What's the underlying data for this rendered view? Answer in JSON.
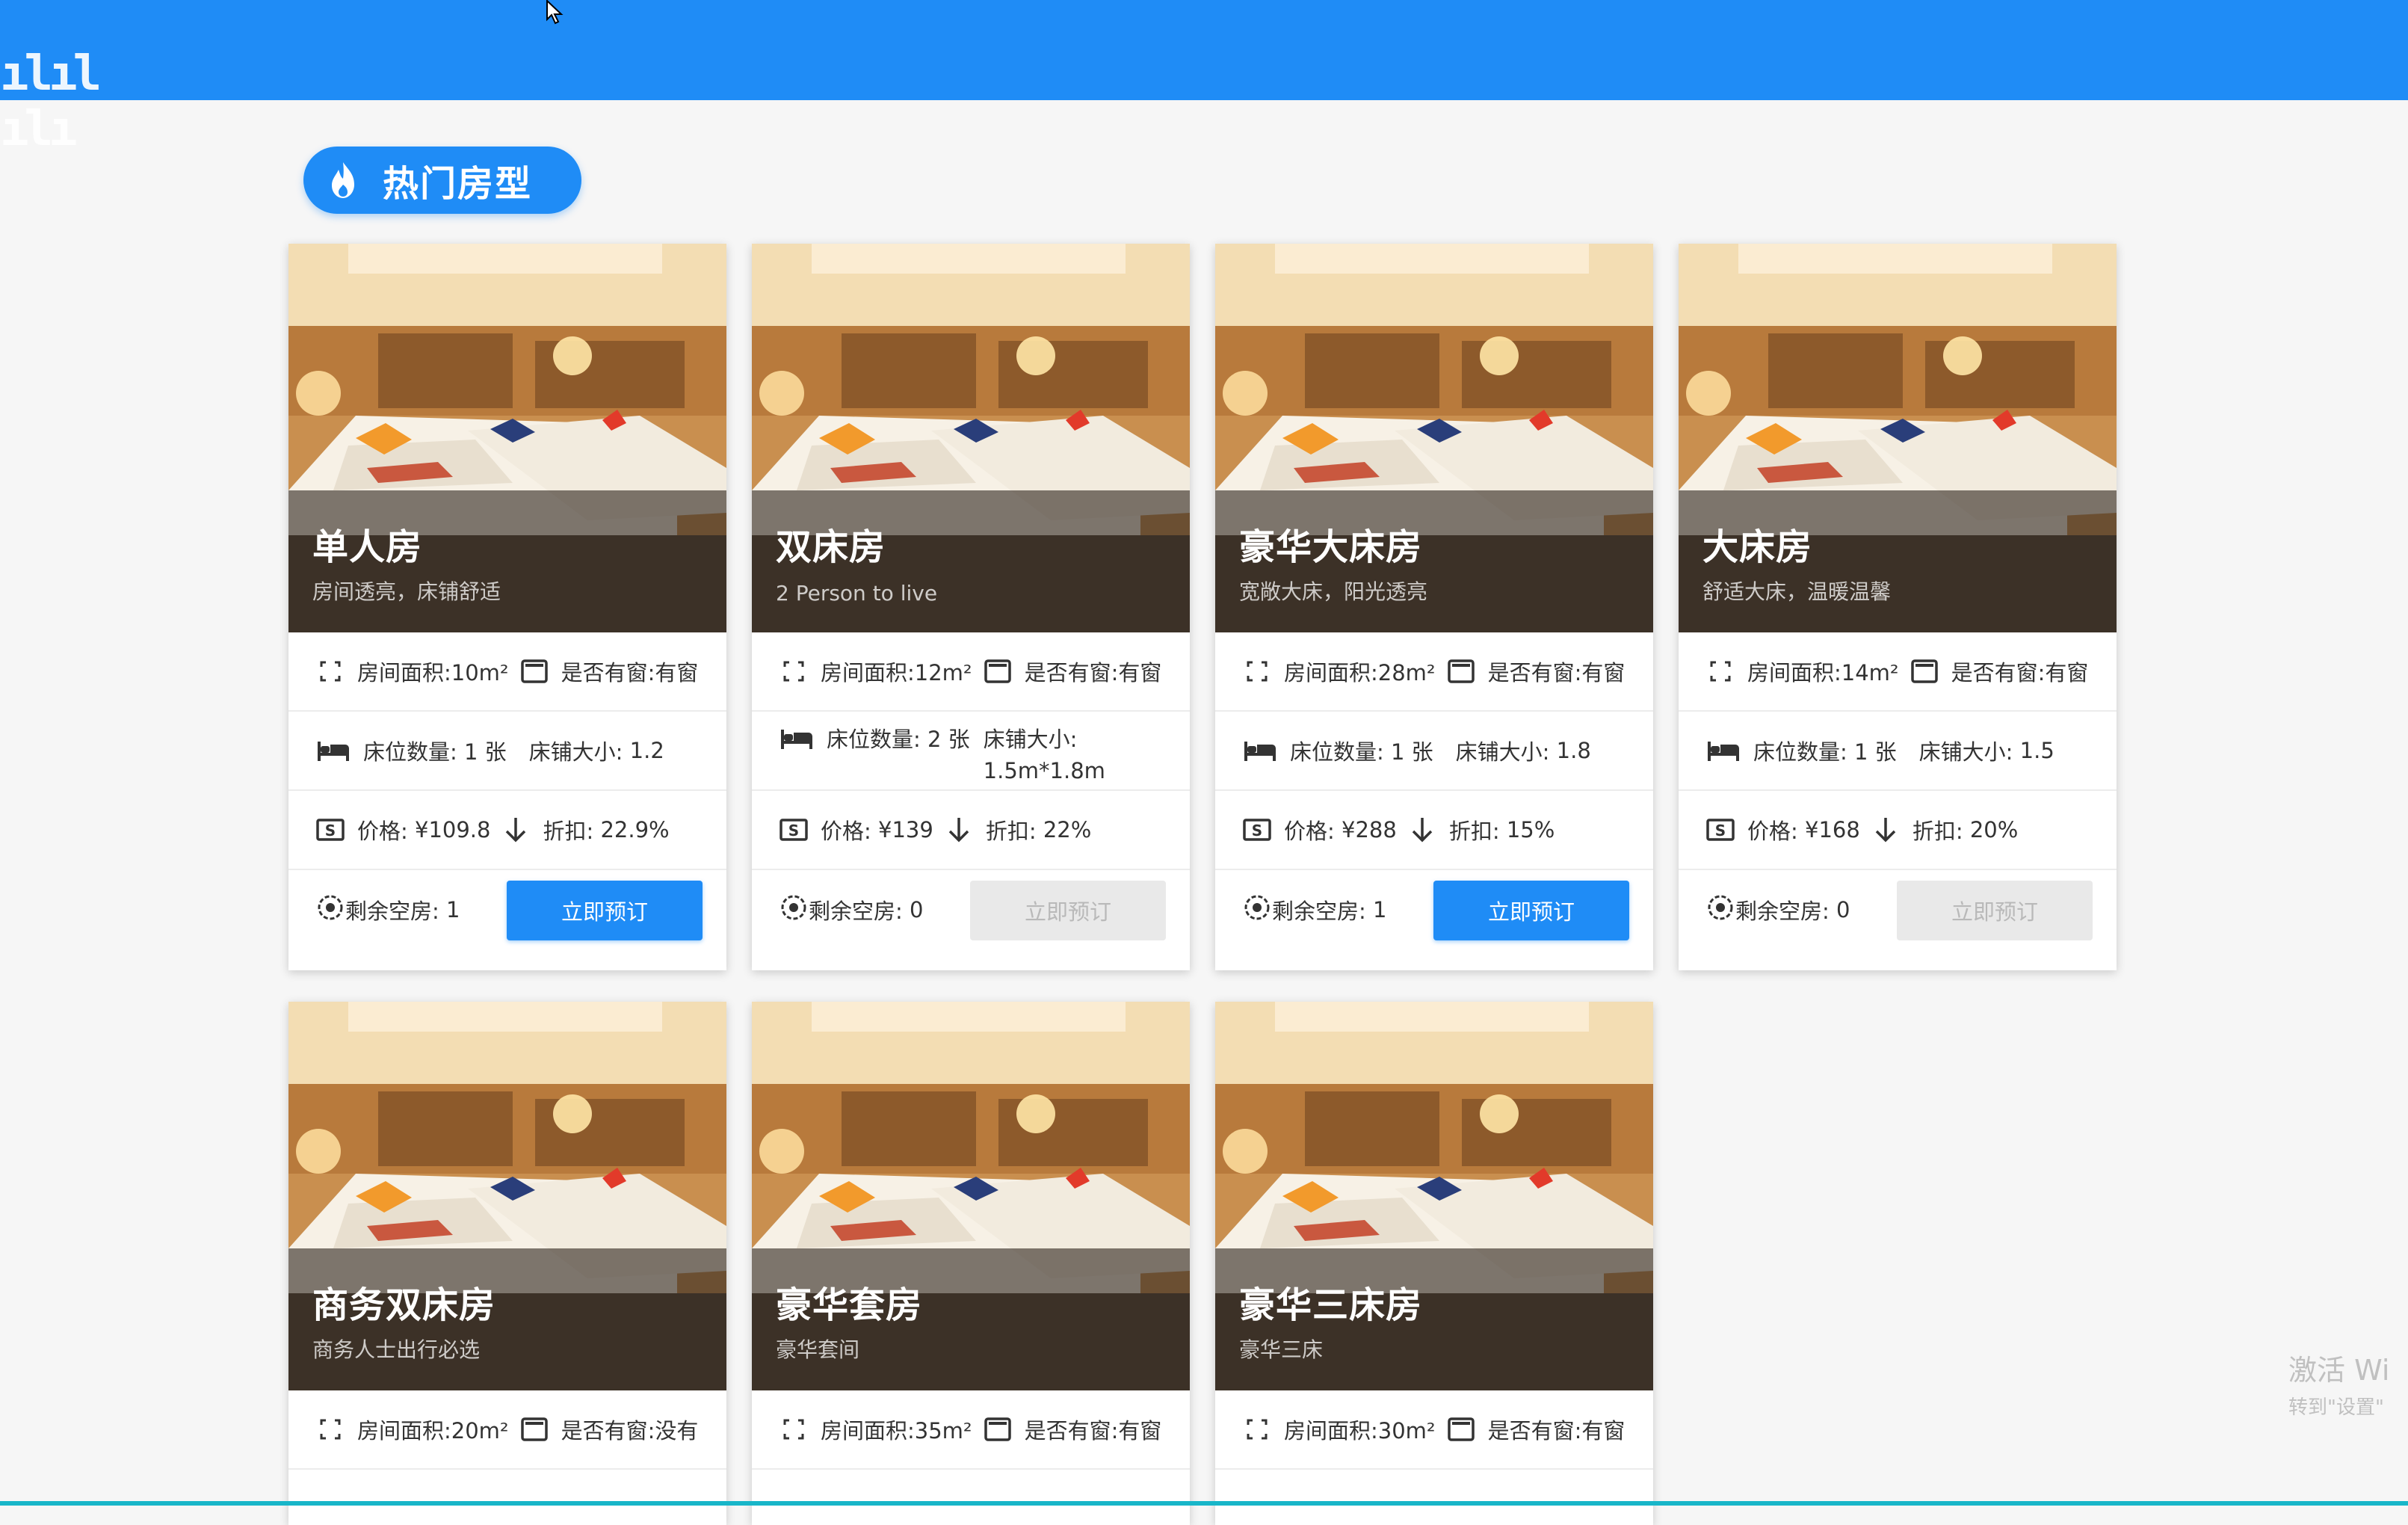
{
  "page": {
    "section_title": "热门房型",
    "brand_color": "#1f8cf6"
  },
  "logo": {
    "text": "ılıl ılı",
    "icon": "bilibili-logo-icon"
  },
  "rooms": [
    {
      "name": "单人房",
      "desc": "房间透亮，床铺舒适",
      "area": "房间面积:10m²",
      "window": "是否有窗:有窗",
      "beds_label": "床位数量:",
      "beds": "1 张",
      "bed_size_label": "床铺大小:",
      "bed_size": "1.2",
      "price_label": "价格:",
      "price": "¥109.8",
      "discount_label": "折扣:",
      "discount": "22.9%",
      "stock_label": "剩余空房:",
      "stock": "1",
      "button": "立即预订",
      "available": true
    },
    {
      "name": "双床房",
      "desc": "2 Person to live",
      "area": "房间面积:12m²",
      "window": "是否有窗:有窗",
      "beds_label": "床位数量:",
      "beds": "2 张",
      "bed_size_label": "床铺大小:",
      "bed_size": "1.5m*1.8m",
      "price_label": "价格:",
      "price": "¥139",
      "discount_label": "折扣:",
      "discount": "22%",
      "stock_label": "剩余空房:",
      "stock": "0",
      "button": "立即预订",
      "available": false
    },
    {
      "name": "豪华大床房",
      "desc": "宽敞大床，阳光透亮",
      "area": "房间面积:28m²",
      "window": "是否有窗:有窗",
      "beds_label": "床位数量:",
      "beds": "1 张",
      "bed_size_label": "床铺大小:",
      "bed_size": "1.8",
      "price_label": "价格:",
      "price": "¥288",
      "discount_label": "折扣:",
      "discount": "15%",
      "stock_label": "剩余空房:",
      "stock": "1",
      "button": "立即预订",
      "available": true
    },
    {
      "name": "大床房",
      "desc": "舒适大床，温暖温馨",
      "area": "房间面积:14m²",
      "window": "是否有窗:有窗",
      "beds_label": "床位数量:",
      "beds": "1 张",
      "bed_size_label": "床铺大小:",
      "bed_size": "1.5",
      "price_label": "价格:",
      "price": "¥168",
      "discount_label": "折扣:",
      "discount": "20%",
      "stock_label": "剩余空房:",
      "stock": "0",
      "button": "立即预订",
      "available": false
    },
    {
      "name": "商务双床房",
      "desc": "商务人士出行必选",
      "area": "房间面积:20m²",
      "window": "是否有窗:没有"
    },
    {
      "name": "豪华套房",
      "desc": "豪华套间",
      "area": "房间面积:35m²",
      "window": "是否有窗:有窗"
    },
    {
      "name": "豪华三床房",
      "desc": "豪华三床",
      "area": "房间面积:30m²",
      "window": "是否有窗:有窗"
    }
  ],
  "watermark": {
    "line1": "激活 Wi",
    "line2": "转到\"设置\""
  },
  "icons": {
    "area": "expand-icon",
    "window": "window-icon",
    "bed": "bed-icon",
    "price": "dollar-icon",
    "discount": "arrow-down-icon",
    "stock": "target-icon",
    "fire": "fire-icon"
  }
}
